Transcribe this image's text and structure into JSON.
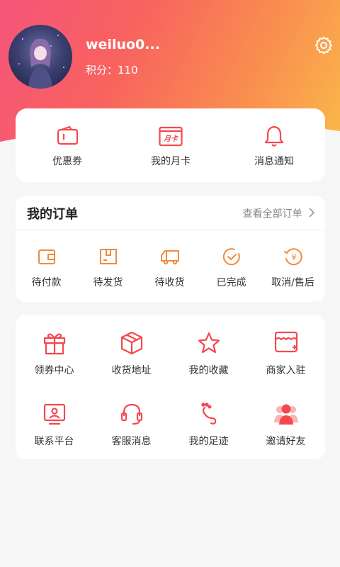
{
  "profile": {
    "username": "weiluo0...",
    "points_label": "积分：110"
  },
  "quick_actions": [
    {
      "label": "优惠券",
      "icon": "coupon-icon"
    },
    {
      "label": "我的月卡",
      "icon": "monthly-card-icon",
      "icon_text": "月卡"
    },
    {
      "label": "消息通知",
      "icon": "bell-icon"
    }
  ],
  "orders": {
    "title": "我的订单",
    "view_all": "查看全部订单",
    "items": [
      {
        "label": "待付款",
        "icon": "wallet-icon"
      },
      {
        "label": "待发货",
        "icon": "package-icon"
      },
      {
        "label": "待收货",
        "icon": "truck-icon"
      },
      {
        "label": "已完成",
        "icon": "check-circle-icon"
      },
      {
        "label": "取消/售后",
        "icon": "refund-yen-icon",
        "icon_text": "¥"
      }
    ]
  },
  "services": [
    {
      "label": "领券中心",
      "icon": "gift-icon"
    },
    {
      "label": "收货地址",
      "icon": "box-icon"
    },
    {
      "label": "我的收藏",
      "icon": "star-icon"
    },
    {
      "label": "商家入驻",
      "icon": "store-icon"
    },
    {
      "label": "联系平台",
      "icon": "monitor-icon"
    },
    {
      "label": "客服消息",
      "icon": "headset-icon"
    },
    {
      "label": "我的足迹",
      "icon": "footprint-icon"
    },
    {
      "label": "邀请好友",
      "icon": "users-icon"
    }
  ],
  "colors": {
    "accent": "#f5484e",
    "orange": "#f08a3c",
    "hero_start": "#f6557a",
    "hero_end": "#fab94a"
  }
}
